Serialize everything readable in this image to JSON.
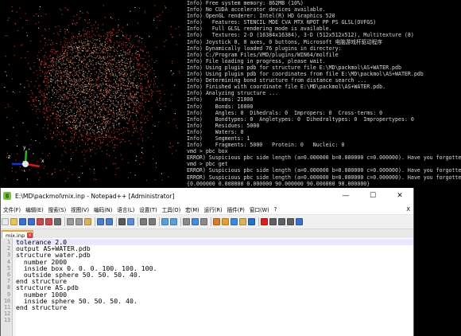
{
  "console": {
    "lines": [
      "Info) Free system memory: 862MB (10%)",
      "Info) No CUDA accelerator devices available.",
      "Info) OpenGL renderer: Intel(R) HD Graphics 520",
      "Info)   Features: STENCIL MDE CVA MTX NPOT PP PS GLSL(OVFGS)",
      "Info)   Full GLSL rendering mode is available.",
      "Info)   Textures: 2-D (16384x16384), 3-D (512x512x512), Multitexture (8)",
      "Info) Joystick 0, 0 axes, 0 buttons, Microsoft 电脑游戏杆驱动程序",
      "Info) Dynamically loaded 76 plugins in directory:",
      "Info) C:/Program Files/VMD/plugins/WIN64/molfile",
      "Info) File loading in progress, please wait.",
      "Info) Using plugin pdb for structure file E:\\MD\\packmol\\AS+WATER.pdb",
      "Info) Using plugin pdb for coordinates from file E:\\MD\\packmol\\AS+WATER.pdb",
      "Info) Determining bond structure from distance search ...",
      "Info) Finished with coordinate file E:\\MD\\packmol\\AS+WATER.pdb.",
      "Info) Analyzing structure ...",
      "Info)    Atoms: 21000",
      "Info)    Bonds: 16000",
      "Info)    Angles: 0  Dihedrals: 0  Impropers: 0  Cross-terms: 0",
      "Info)    Bondtypes: 0  Angletypes: 0  Dihedraltypes: 0  Impropertypes: 0",
      "Info)    Residues: 5000",
      "Info)    Waters: 0",
      "Info)    Segments: 1",
      "Info)    Fragments: 5000   Protein: 0   Nucleic: 0",
      "vmd > pbc box",
      "ERROR) Suspicious pbc side length (a=0.000000 b=0.000000 c=0.000000). Have you forgotten",
      "vmd > pbc get",
      "ERROR) Suspicious pbc side length (a=0.000000 b=0.000000 c=0.000000). Have you forgotten",
      "ERROR) Suspicious pbc side length (a=0.000000 b=0.000000 c=0.000000). Have you forgotten",
      "{0.000000 0.000000 0.000000 90.000000 90.000000 90.000000}",
      "vmd >"
    ]
  },
  "axes": {
    "x_label": "x",
    "y_label": "y",
    "z_label": "z"
  },
  "notepad": {
    "title": "E:\\MD\\packmol\\mix.inp - Notepad++ [Administrator]",
    "window_controls": {
      "minimize": "—",
      "maximize": "☐",
      "close": "✕"
    },
    "menu": [
      "文件(F)",
      "编辑(E)",
      "搜索(S)",
      "视图(V)",
      "编码(N)",
      "语言(L)",
      "设置(T)",
      "工具(O)",
      "宏(M)",
      "运行(R)",
      "插件(P)",
      "窗口(W)",
      "?"
    ],
    "menu_close": "X",
    "tab": {
      "label": "mix.inp",
      "close": "×"
    },
    "line_numbers": [
      "1",
      "2",
      "3",
      "4",
      "5",
      "6",
      "7",
      "8",
      "9",
      "10",
      "11",
      "12",
      "13"
    ],
    "code_lines": [
      "tolerance 2.0",
      "output AS+WATER.pdb",
      "structure water.pdb",
      "  number 2000",
      "  inside box 0. 0. 0. 100. 100. 100.",
      "  outside sphere 50. 50. 50. 40.",
      "end structure",
      "structure AS.pdb",
      "  number 1000",
      "  inside sphere 50. 50. 50. 40.",
      "end structure",
      "",
      ""
    ],
    "toolbar_icons": [
      "new-file-icon",
      "open-file-icon",
      "save-icon",
      "save-all-icon",
      "close-icon",
      "close-all-icon",
      "print-icon",
      "cut-icon",
      "copy-icon",
      "paste-icon",
      "undo-icon",
      "redo-icon",
      "find-icon",
      "replace-icon",
      "zoom-in-icon",
      "zoom-out-icon",
      "sync-vertical-icon",
      "sync-horizontal-icon",
      "word-wrap-icon",
      "show-all-chars-icon",
      "indent-guide-icon",
      "udl-icon",
      "doc-map-icon",
      "function-list-icon",
      "folder-workspace-icon",
      "monitoring-icon",
      "record-macro-icon",
      "stop-macro-icon",
      "play-macro-icon",
      "run-macro-multiple-icon",
      "save-macro-icon"
    ],
    "toolbar_colors": [
      "#e8e8e8",
      "#e8c25a",
      "#3b6fc9",
      "#3b6fc9",
      "#c84a4a",
      "#c84a4a",
      "#6d6d6d",
      "#9a9a9a",
      "#9a9a9a",
      "#d6b25a",
      "#4a7ac8",
      "#4a7ac8",
      "#5a5a5a",
      "#5a8ad8",
      "#7a7a7a",
      "#7a7a7a",
      "#5aa0d8",
      "#5aa0d8",
      "#8a8a8a",
      "#4a8ad8",
      "#8a8a8a",
      "#d87a2a",
      "#e6a030",
      "#3a8ad8",
      "#d6b25a",
      "#2a70c0",
      "#d82020",
      "#606060",
      "#606060",
      "#606060",
      "#3b6fc9"
    ]
  }
}
